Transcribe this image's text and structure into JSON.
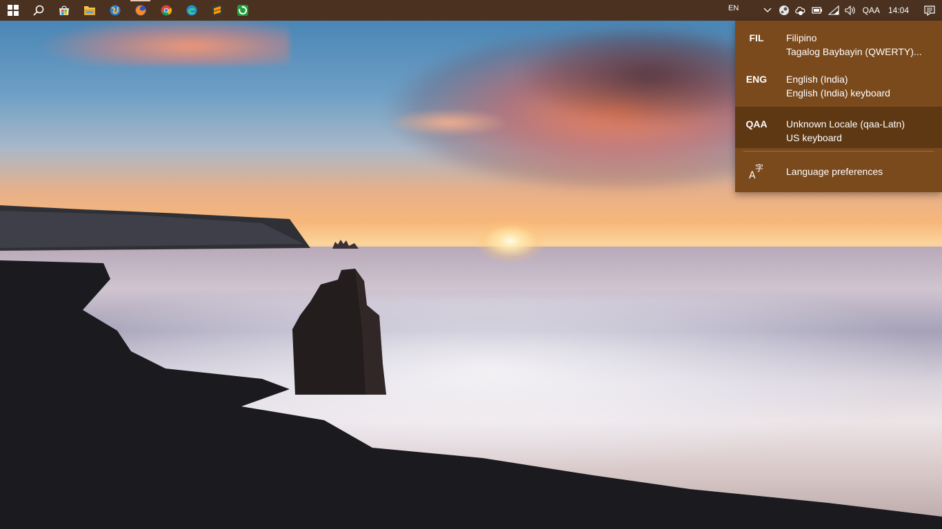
{
  "taskbar": {
    "pinned_apps": [
      {
        "name": "start",
        "icon": "windows-logo-icon"
      },
      {
        "name": "search",
        "icon": "search-icon"
      },
      {
        "name": "store",
        "icon": "store-bag-icon"
      },
      {
        "name": "file-explorer",
        "icon": "folder-icon"
      },
      {
        "name": "browser-globe",
        "icon": "globe-icon"
      },
      {
        "name": "firefox",
        "icon": "firefox-icon"
      },
      {
        "name": "chrome",
        "icon": "chrome-icon"
      },
      {
        "name": "edge",
        "icon": "edge-icon"
      },
      {
        "name": "sublime-text",
        "icon": "sublime-icon"
      },
      {
        "name": "update-app",
        "icon": "green-update-icon"
      }
    ],
    "active_app": "firefox",
    "tray": {
      "language_short": "EN",
      "input_method": "QAA",
      "time": "14:04"
    }
  },
  "language_flyout": {
    "items": [
      {
        "code": "FIL",
        "language": "Filipino",
        "keyboard": "Tagalog Baybayin (QWERTY)...",
        "selected": false
      },
      {
        "code": "ENG",
        "language": "English (India)",
        "keyboard": "English (India) keyboard",
        "selected": false
      },
      {
        "code": "QAA",
        "language": "Unknown Locale (qaa-Latn)",
        "keyboard": "US keyboard",
        "selected": true
      }
    ],
    "preferences_label": "Language preferences"
  },
  "colors": {
    "taskbar_bg": "#4a3120",
    "flyout_bg": "#7a4a1d",
    "flyout_selected_bg": "#5e3813"
  }
}
